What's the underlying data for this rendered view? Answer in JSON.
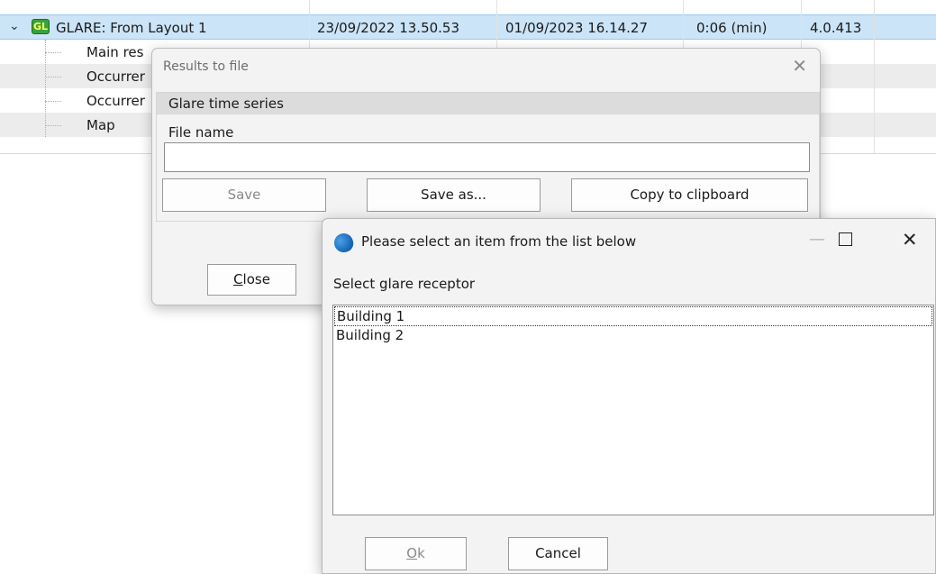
{
  "tree": {
    "parent": {
      "icon": "GL",
      "name": "GLARE: From Layout 1",
      "created": "23/09/2022 13.50.53",
      "calculated": "01/09/2023 16.14.27",
      "duration": "0:06 (min)",
      "version": "4.0.413"
    },
    "children": [
      "Main res",
      "Occurrer",
      "Occurrer",
      "Map"
    ]
  },
  "results_dialog": {
    "title": "Results to file",
    "group_title": "Glare time series",
    "file_name_label": "File name",
    "file_name_value": "",
    "save_label": "Save",
    "save_as_label": "Save as...",
    "copy_label": "Copy to clipboard",
    "close_label_accel": "C",
    "close_label_rest": "lose"
  },
  "select_dialog": {
    "title": "Please select an item from the list below",
    "prompt": "Select glare receptor",
    "items": [
      "Building 1",
      "Building 2"
    ],
    "focused_index": 0,
    "ok_accel": "O",
    "ok_rest": "k",
    "cancel_label": "Cancel"
  },
  "colors": {
    "selected_row": "#cce4f7",
    "alt_row": "#ececec",
    "dialog_bg": "#f3f3f3"
  }
}
